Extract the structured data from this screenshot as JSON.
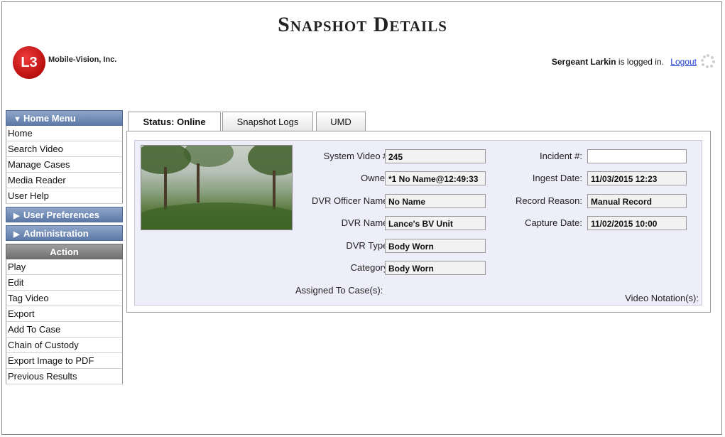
{
  "header": {
    "title": "Snapshot Details",
    "company": "Mobile-Vision, Inc.",
    "logo_text": "L3",
    "user_name": "Sergeant Larkin",
    "user_suffix": " is logged in.",
    "logout": "Logout"
  },
  "sidebar": {
    "home_menu": {
      "label": "Home Menu",
      "items": [
        "Home",
        "Search Video",
        "Manage Cases",
        "Media Reader",
        "User Help"
      ]
    },
    "user_preferences": "User Preferences",
    "administration": "Administration",
    "action": {
      "label": "Action",
      "items": [
        "Play",
        "Edit",
        "Tag Video",
        "Export",
        "Add To Case",
        "Chain of Custody",
        "Export Image to PDF",
        "Previous Results"
      ]
    }
  },
  "tabs": [
    "Status: Online",
    "Snapshot Logs",
    "UMD"
  ],
  "details": {
    "system_video_label": "System Video #:",
    "system_video": "245",
    "owner_label": "Owner:",
    "owner": "*1 No Name@12:49:33",
    "dvr_officer_label": "DVR Officer Name:",
    "dvr_officer": "No Name",
    "dvr_name_label": "DVR Name:",
    "dvr_name": "Lance's BV Unit",
    "dvr_type_label": "DVR Type:",
    "dvr_type": "Body Worn",
    "category_label": "Category:",
    "category": "Body Worn",
    "incident_label": "Incident #:",
    "incident": "",
    "ingest_label": "Ingest Date:",
    "ingest": "11/03/2015 12:23",
    "reason_label": "Record Reason:",
    "reason": "Manual Record",
    "capture_label": "Capture Date:",
    "capture": "11/02/2015 10:00",
    "assigned_label": "Assigned To Case(s):",
    "notation_label": "Video Notation(s):"
  },
  "colors": {
    "menu_header": "#6b86b5",
    "action_header": "#808080",
    "detail_background": "#eeeefa",
    "logo": "#d01818",
    "link": "#1a3fd1"
  }
}
